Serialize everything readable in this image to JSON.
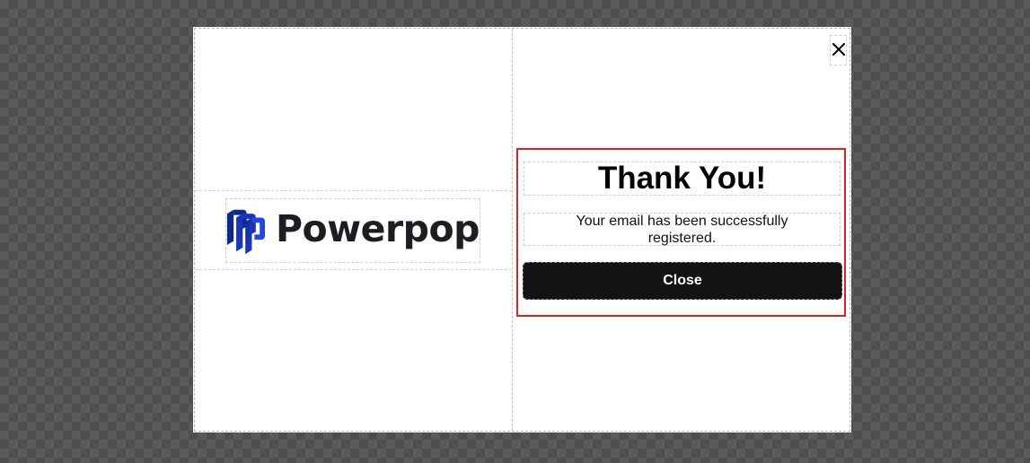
{
  "brand": {
    "name": "Powerpop",
    "logo_icon": "powerpop-logo-mark",
    "logo_color": "#1f3fd6"
  },
  "dialog": {
    "close_icon": "close-icon",
    "title": "Thank You!",
    "message": "Your email has been successfully registered.",
    "close_button_label": "Close",
    "highlight_color": "#d42424",
    "button_color": "#131313"
  }
}
